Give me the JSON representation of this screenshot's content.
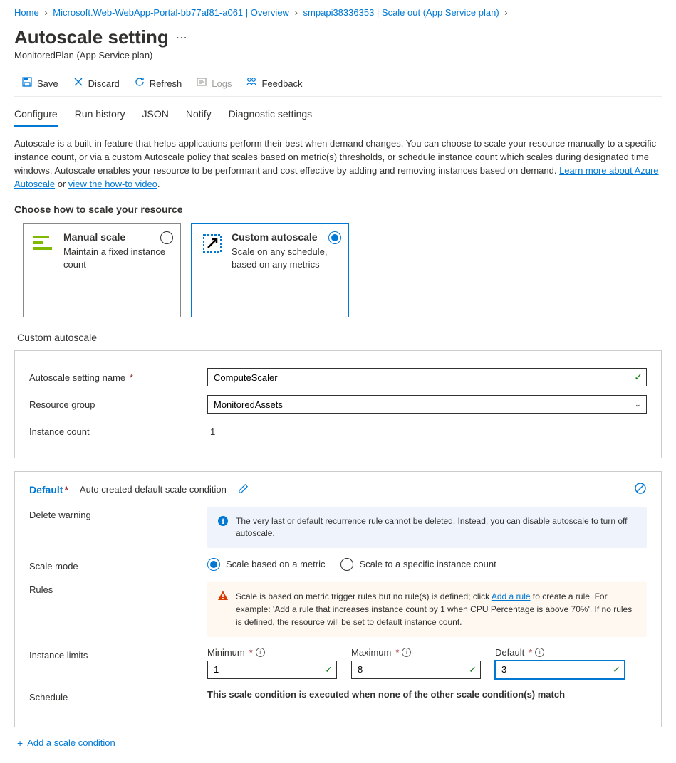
{
  "breadcrumb": {
    "home": "Home",
    "item1": "Microsoft.Web-WebApp-Portal-bb77af81-a061 | Overview",
    "item2": "smpapi38336353 | Scale out (App Service plan)"
  },
  "page": {
    "title": "Autoscale setting",
    "subtitle": "MonitoredPlan (App Service plan)"
  },
  "toolbar": {
    "save": "Save",
    "discard": "Discard",
    "refresh": "Refresh",
    "logs": "Logs",
    "feedback": "Feedback"
  },
  "tabs": {
    "configure": "Configure",
    "run_history": "Run history",
    "json": "JSON",
    "notify": "Notify",
    "diag": "Diagnostic settings"
  },
  "intro": {
    "text1": "Autoscale is a built-in feature that helps applications perform their best when demand changes. You can choose to scale your resource manually to a specific instance count, or via a custom Autoscale policy that scales based on metric(s) thresholds, or schedule instance count which scales during designated time windows. Autoscale enables your resource to be performant and cost effective by adding and removing instances based on demand. ",
    "link1": "Learn more about Azure Autoscale",
    "text2": " or ",
    "link2": "view the how-to video",
    "text3": "."
  },
  "choose_label": "Choose how to scale your resource",
  "cards": {
    "manual": {
      "title": "Manual scale",
      "desc": "Maintain a fixed instance count"
    },
    "custom": {
      "title": "Custom autoscale",
      "desc": "Scale on any schedule, based on any metrics"
    }
  },
  "custom_section_title": "Custom autoscale",
  "form": {
    "name_label": "Autoscale setting name",
    "name_value": "ComputeScaler",
    "rg_label": "Resource group",
    "rg_value": "MonitoredAssets",
    "instance_count_label": "Instance count",
    "instance_count_value": "1"
  },
  "condition": {
    "name": "Default",
    "subtitle": "Auto created default scale condition",
    "delete_warning_label": "Delete warning",
    "delete_warning_text": "The very last or default recurrence rule cannot be deleted. Instead, you can disable autoscale to turn off autoscale.",
    "scale_mode_label": "Scale mode",
    "mode_metric": "Scale based on a metric",
    "mode_specific": "Scale to a specific instance count",
    "rules_label": "Rules",
    "rules_warn_pre": "Scale is based on metric trigger rules but no rule(s) is defined; click ",
    "rules_warn_link": "Add a rule",
    "rules_warn_post": " to create a rule. For example: 'Add a rule that increases instance count by 1 when CPU Percentage is above 70%'. If no rules is defined, the resource will be set to default instance count.",
    "limits_label": "Instance limits",
    "min_label": "Minimum",
    "min_value": "1",
    "max_label": "Maximum",
    "max_value": "8",
    "def_label": "Default",
    "def_value": "3",
    "schedule_label": "Schedule",
    "schedule_text": "This scale condition is executed when none of the other scale condition(s) match"
  },
  "add_condition": "Add a scale condition"
}
